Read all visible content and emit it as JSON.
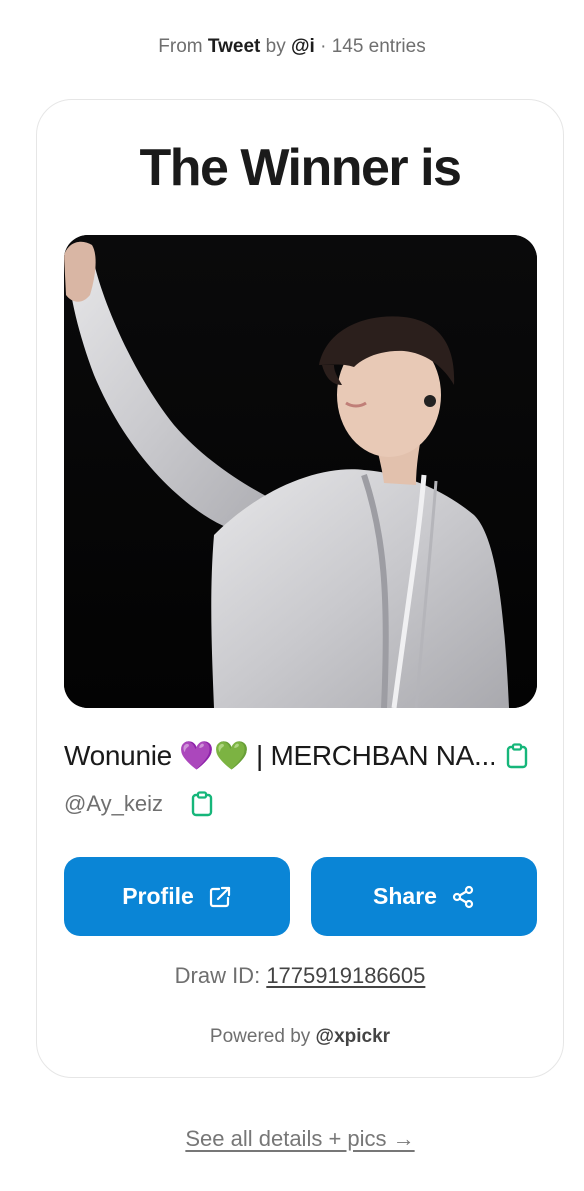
{
  "header": {
    "prefix": "From",
    "source": "Tweet",
    "by": "by",
    "author": "@i",
    "separator": "·",
    "entries": "145 entries"
  },
  "card": {
    "title": "The Winner is",
    "photo_icon": "winner-photo",
    "winner_name": "Wonunie 💜💚 | MERCHBAN NA...",
    "winner_handle": "@Ay_keiz",
    "copy_icon": "clipboard-icon",
    "profile_button": {
      "label": "Profile",
      "icon": "external-link-icon"
    },
    "share_button": {
      "label": "Share",
      "icon": "share-icon"
    },
    "draw_id_label": "Draw ID:",
    "draw_id_value": "1775919186605",
    "powered_prefix": "Powered by",
    "powered_by": "@xpickr"
  },
  "footer": {
    "details_link": "See all details + pics →"
  },
  "colors": {
    "accent": "#0a85d6",
    "copy_icon": "#16b67a",
    "muted_text": "#6f6f6f"
  }
}
